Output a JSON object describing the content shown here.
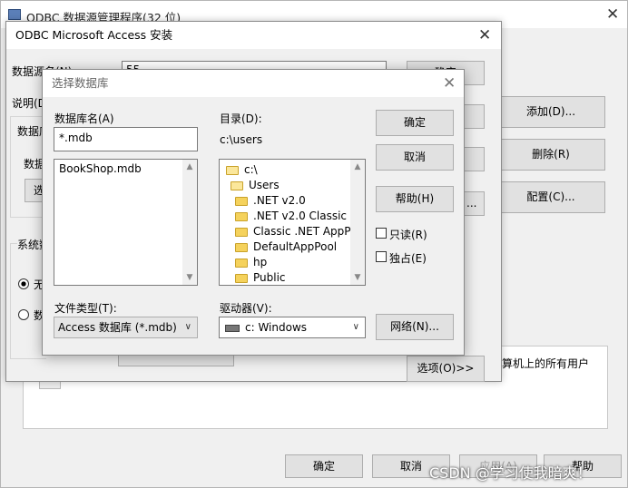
{
  "admin": {
    "title": "ODBC 数据源管理程序(32 位)",
    "add": "添加(D)...",
    "remove": "删除(R)",
    "configure": "配置(C)...",
    "footer_note": "算机上的所有用户",
    "ok": "确定",
    "cancel": "取消",
    "apply": "应用(A)",
    "help": "帮助"
  },
  "setup": {
    "title": "ODBC Microsoft Access 安装",
    "dsn_label": "数据源名(N):",
    "dsn_value": "55",
    "desc_label": "说明(D",
    "db_label": "数据库",
    "db_sub": "数据",
    "select_btn": "选",
    "sys_label": "系统数",
    "radio_none": "无",
    "radio_db": "数",
    "options": "选项(O)>>",
    "ok": "确定",
    "dots": "..."
  },
  "select_db": {
    "title": "选择数据库",
    "db_name_label": "数据库名(A)",
    "db_name_value": "*.mdb",
    "files": [
      "BookShop.mdb"
    ],
    "dir_label": "目录(D):",
    "dir_value": "c:\\users",
    "tree": [
      {
        "name": "c:\\",
        "open": true,
        "indent": 0
      },
      {
        "name": "Users",
        "open": true,
        "indent": 1
      },
      {
        "name": ".NET v2.0",
        "open": false,
        "indent": 2
      },
      {
        "name": ".NET v2.0 Classic",
        "open": false,
        "indent": 2
      },
      {
        "name": "Classic .NET AppPool",
        "open": false,
        "indent": 2
      },
      {
        "name": "DefaultAppPool",
        "open": false,
        "indent": 2
      },
      {
        "name": "hp",
        "open": false,
        "indent": 2
      },
      {
        "name": "Public",
        "open": false,
        "indent": 2
      }
    ],
    "filetype_label": "文件类型(T):",
    "filetype_value": "Access 数据库 (*.mdb)",
    "drive_label": "驱动器(V):",
    "drive_value": "c: Windows",
    "ok": "确定",
    "cancel": "取消",
    "help": "帮助(H)",
    "readonly": "只读(R)",
    "exclusive": "独占(E)",
    "network": "网络(N)..."
  },
  "watermark": "CSDN @学习使我暗爽！"
}
